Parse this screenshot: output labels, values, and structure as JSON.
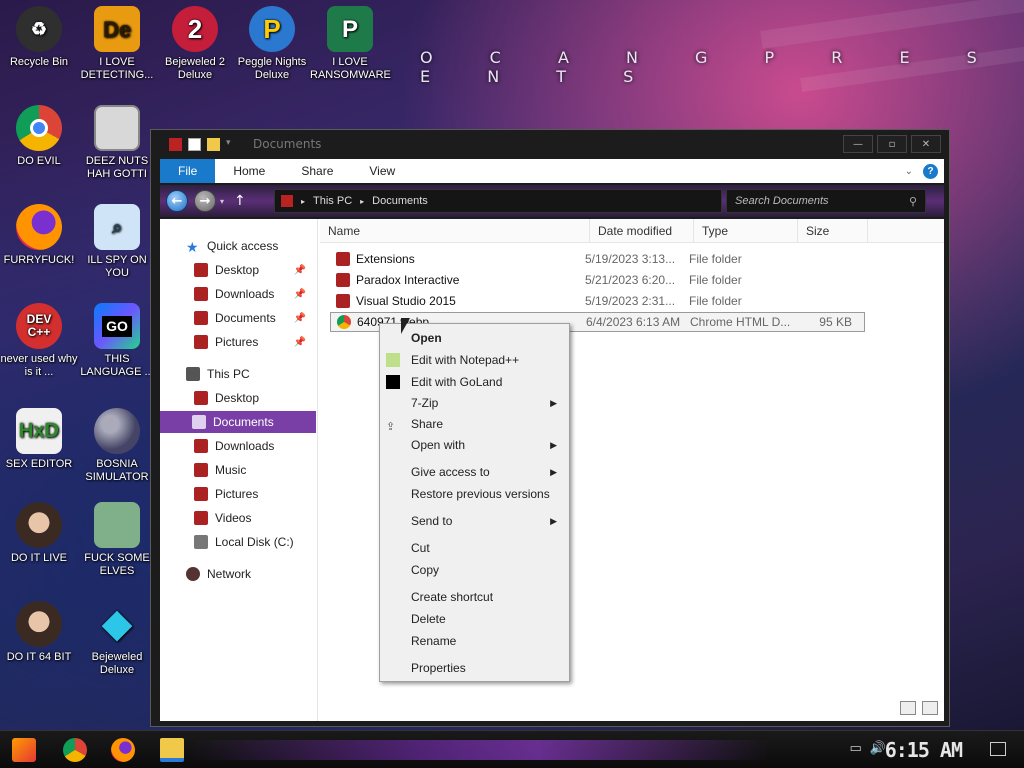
{
  "wallpaper": {
    "banner_text": "O C A N G   P R E S E N T S"
  },
  "desktop_icons": [
    {
      "label": "Recycle Bin",
      "icon": "recycle-bin-icon",
      "color": "#3a3a3a"
    },
    {
      "label": "I LOVE DETECTING...",
      "icon": "detective-app-icon",
      "color": "#d88a0c"
    },
    {
      "label": "Bejeweled 2 Deluxe",
      "icon": "bejeweled-icon",
      "color": "#c41e3a"
    },
    {
      "label": "Peggle Nights Deluxe",
      "icon": "peggle-icon",
      "color": "#2a78d0"
    },
    {
      "label": "I LOVE RANSOMWARE",
      "icon": "project-app-icon",
      "color": "#1f7a4a"
    },
    {
      "label": "DO EVIL",
      "icon": "chrome-icon",
      "color": "#dd4b39"
    },
    {
      "label": "DEEZ NUTS HAH GOTTI",
      "icon": "windows-stack-icon",
      "color": "#7a7a7a"
    },
    {
      "label": "FURRYFUCK!",
      "icon": "firefox-icon",
      "color": "#ff7a00"
    },
    {
      "label": "ILL SPY ON YOU",
      "icon": "spy-app-icon",
      "color": "#5a8cc0"
    },
    {
      "label": "never used why is it ...",
      "icon": "devcpp-icon",
      "color": "#d32f2f"
    },
    {
      "label": "THIS LANGUAGE ...",
      "icon": "goland-icon",
      "color": "#3b5bd6"
    },
    {
      "label": "SEX EDITOR",
      "icon": "hex-editor-icon",
      "color": "#e8e8e8"
    },
    {
      "label": "BOSNIA SIMULATOR",
      "icon": "mine-icon",
      "color": "#4a4ab0"
    },
    {
      "label": "DO IT LIVE",
      "icon": "portrait-icon",
      "color": "#8a6a5a"
    },
    {
      "label": "FUCK SOME ELVES",
      "icon": "elf-icon",
      "color": "#5fa070"
    },
    {
      "label": "DO IT 64 BIT",
      "icon": "portrait-64-icon",
      "color": "#8a6a5a"
    },
    {
      "label": "Bejeweled Deluxe",
      "icon": "gem-icon",
      "color": "#2bc6e8"
    }
  ],
  "window": {
    "title": "Documents",
    "ribbon_tabs": [
      "File",
      "Home",
      "Share",
      "View"
    ],
    "address_segments": [
      "This PC",
      "Documents"
    ],
    "search_placeholder": "Search Documents",
    "nav": {
      "quick_access": "Quick access",
      "quick_items": [
        "Desktop",
        "Downloads",
        "Documents",
        "Pictures"
      ],
      "this_pc": "This PC",
      "pc_items": [
        "Desktop",
        "Documents",
        "Downloads",
        "Music",
        "Pictures",
        "Videos",
        "Local Disk (C:)"
      ],
      "network": "Network"
    },
    "columns": [
      "Name",
      "Date modified",
      "Type",
      "Size"
    ],
    "files": [
      {
        "name": "Extensions",
        "date": "5/19/2023 3:13...",
        "type": "File folder",
        "size": ""
      },
      {
        "name": "Paradox Interactive",
        "date": "5/21/2023 6:20...",
        "type": "File folder",
        "size": ""
      },
      {
        "name": "Visual Studio 2015",
        "date": "5/19/2023 2:31...",
        "type": "File folder",
        "size": ""
      },
      {
        "name": "640971.webp",
        "date": "6/4/2023 6:13 AM",
        "type": "Chrome HTML D...",
        "size": "95 KB"
      }
    ]
  },
  "context_menu": {
    "items": [
      {
        "label": "Open",
        "bold": true
      },
      {
        "label": "Edit with Notepad++",
        "icon": "notepadpp-icon"
      },
      {
        "label": "Edit with GoLand",
        "icon": "goland-icon"
      },
      {
        "label": "7-Zip",
        "submenu": true
      },
      {
        "label": "Share",
        "icon": "share-icon"
      },
      {
        "label": "Open with",
        "submenu": true
      },
      {
        "label": "Give access to",
        "submenu": true
      },
      {
        "label": "Restore previous versions"
      },
      {
        "label": "Send to",
        "submenu": true
      },
      {
        "label": "Cut"
      },
      {
        "label": "Copy"
      },
      {
        "label": "Create shortcut"
      },
      {
        "label": "Delete"
      },
      {
        "label": "Rename"
      },
      {
        "label": "Properties"
      }
    ]
  },
  "taskbar": {
    "clock": "6:15 AM",
    "pinned": [
      "start-icon",
      "chrome-icon",
      "firefox-icon",
      "file-explorer-icon"
    ]
  }
}
